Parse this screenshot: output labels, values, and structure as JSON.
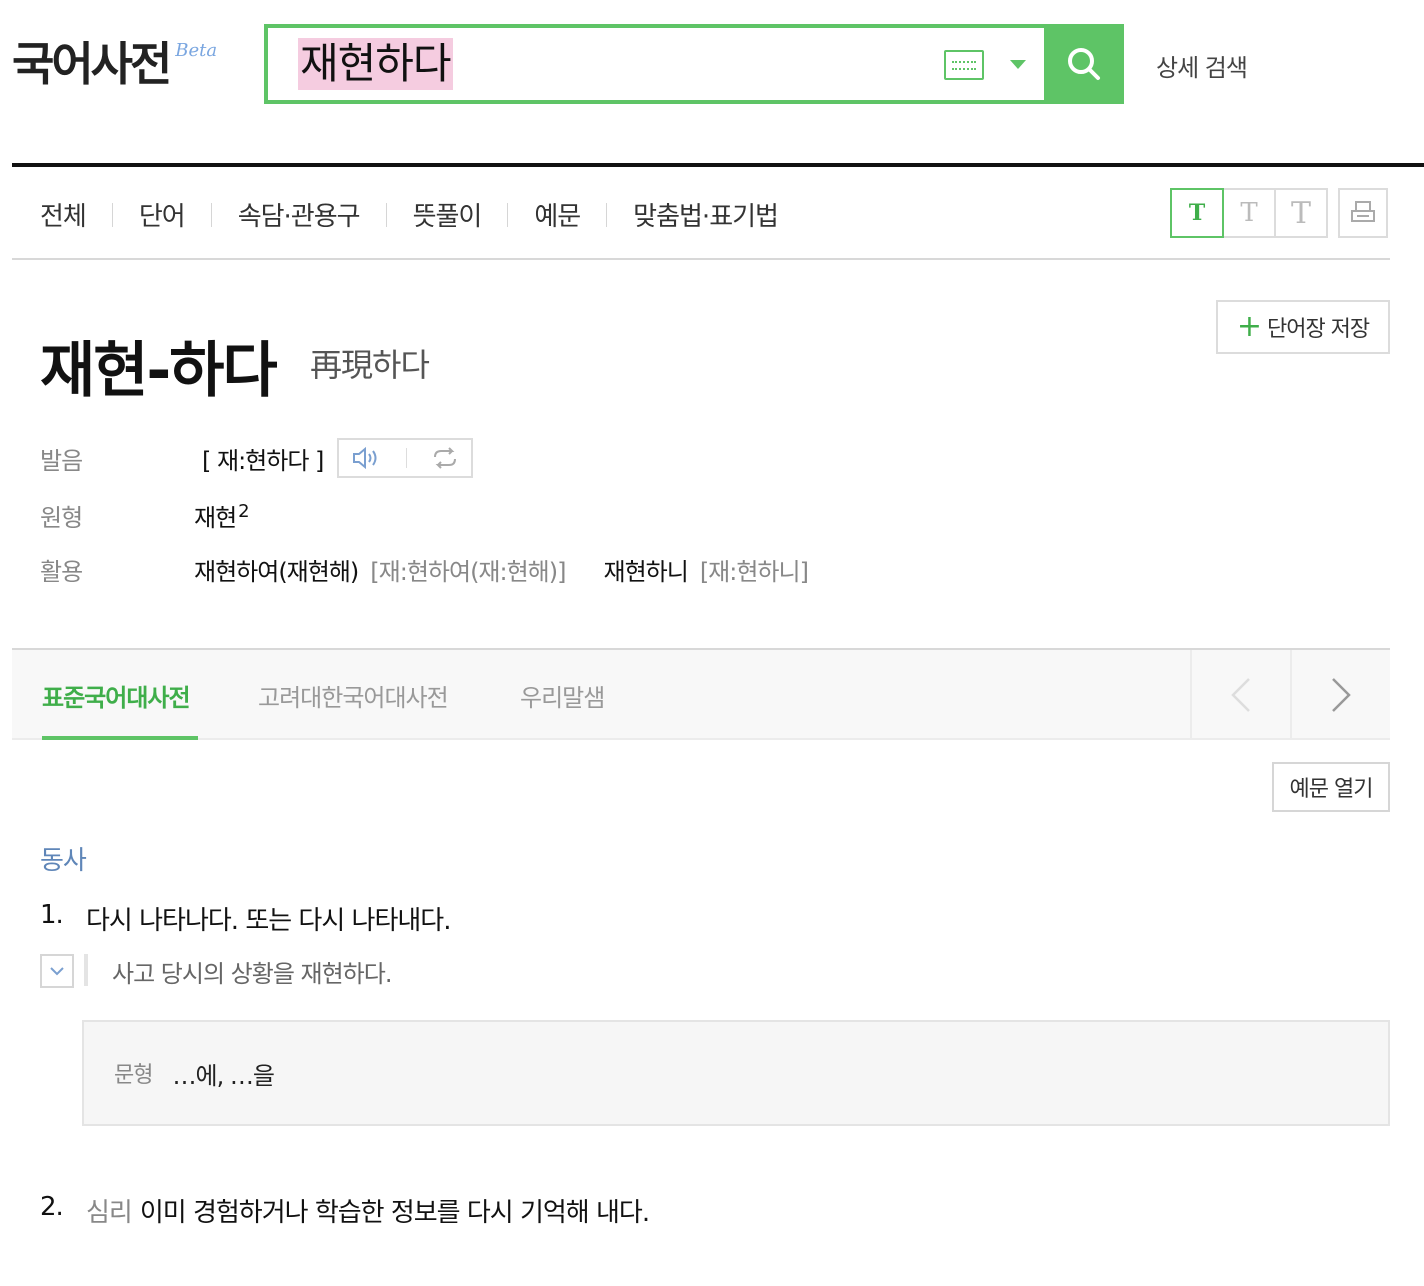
{
  "header": {
    "logo_text": "국어사전",
    "logo_badge": "Beta",
    "search_value": "재현하다",
    "detail_search": "상세 검색"
  },
  "categories": [
    "전체",
    "단어",
    "속담·관용구",
    "뜻풀이",
    "예문",
    "맞춤법·표기법"
  ],
  "font_tools": {
    "small": "T",
    "medium": "T",
    "large": "T"
  },
  "entry": {
    "save_label": "단어장 저장",
    "headword": "재현-하다",
    "hanja": "再現하다",
    "pronunciation": {
      "label": "발음",
      "value": "[ 재:현하다 ]"
    },
    "base_form": {
      "label": "원형",
      "value": "재현",
      "superscript": "2"
    },
    "conjugation": {
      "label": "활용",
      "form1": "재현하여(재현해)",
      "pron1": "[재:현하여(재:현해)]",
      "form2": "재현하니",
      "pron2": "[재:현하니]"
    }
  },
  "dict_tabs": [
    "표준국어대사전",
    "고려대한국어대사전",
    "우리말샘"
  ],
  "example_toggle_label": "예문 열기",
  "part_of_speech": "동사",
  "senses": [
    {
      "number": "1.",
      "field": "",
      "definition": "다시 나타나다. 또는 다시 나타내다.",
      "example": "사고 당시의 상황을 재현하다.",
      "pattern_label": "문형",
      "pattern": "…에, …을"
    },
    {
      "number": "2.",
      "field": "심리",
      "definition": "이미 경험하거나 학습한 정보를 다시 기억해 내다."
    }
  ],
  "colors": {
    "accent": "#5ec466",
    "accent_text": "#3fae4a",
    "highlight": "#f5cce0",
    "pos_blue": "#5f86b8"
  }
}
